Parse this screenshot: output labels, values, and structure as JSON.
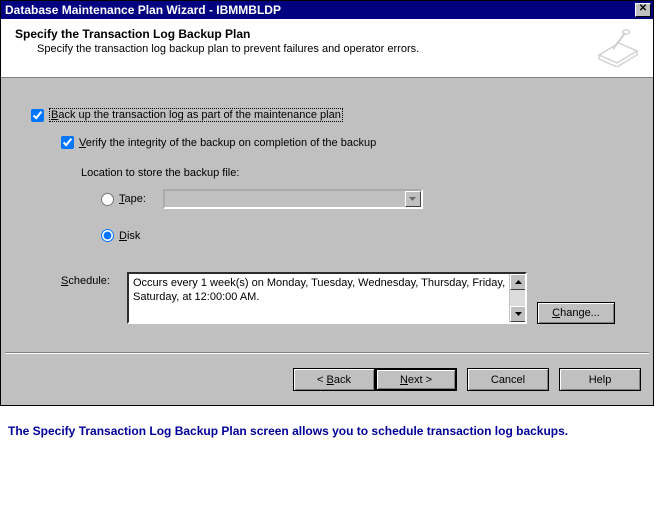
{
  "window": {
    "title": "Database Maintenance Plan Wizard - IBMMBLDP",
    "close_glyph": "✕"
  },
  "header": {
    "title": "Specify the Transaction Log Backup Plan",
    "subtitle": "Specify the transaction log backup plan to prevent failures and operator errors."
  },
  "options": {
    "backup_label_pre": "B",
    "backup_label_rest": "ack up the transaction log as part of the maintenance plan",
    "backup_checked": true,
    "verify_label_pre": "V",
    "verify_label_rest": "erify the integrity of the backup on completion of the backup",
    "verify_checked": true,
    "location_label": "Location to store the backup file:",
    "tape_label_pre": "T",
    "tape_label_rest": "ape:",
    "tape_selected": "",
    "tape_checked": false,
    "disk_label_pre": "D",
    "disk_label_rest": "isk",
    "disk_checked": true
  },
  "schedule": {
    "label_pre": "S",
    "label_rest": "chedule:",
    "text": "Occurs every 1 week(s) on Monday, Tuesday, Wednesday, Thursday, Friday, Saturday, at 12:00:00 AM.",
    "change_label_pre": "C",
    "change_label_rest": "hange..."
  },
  "footer": {
    "back_pre": "B",
    "back_rest": "ack",
    "back_arrow": "< ",
    "next_pre": "N",
    "next_rest": "ext >",
    "cancel": "Cancel",
    "help": "Help"
  },
  "caption": "The Specify Transaction Log Backup Plan screen allows you to schedule transaction log backups."
}
